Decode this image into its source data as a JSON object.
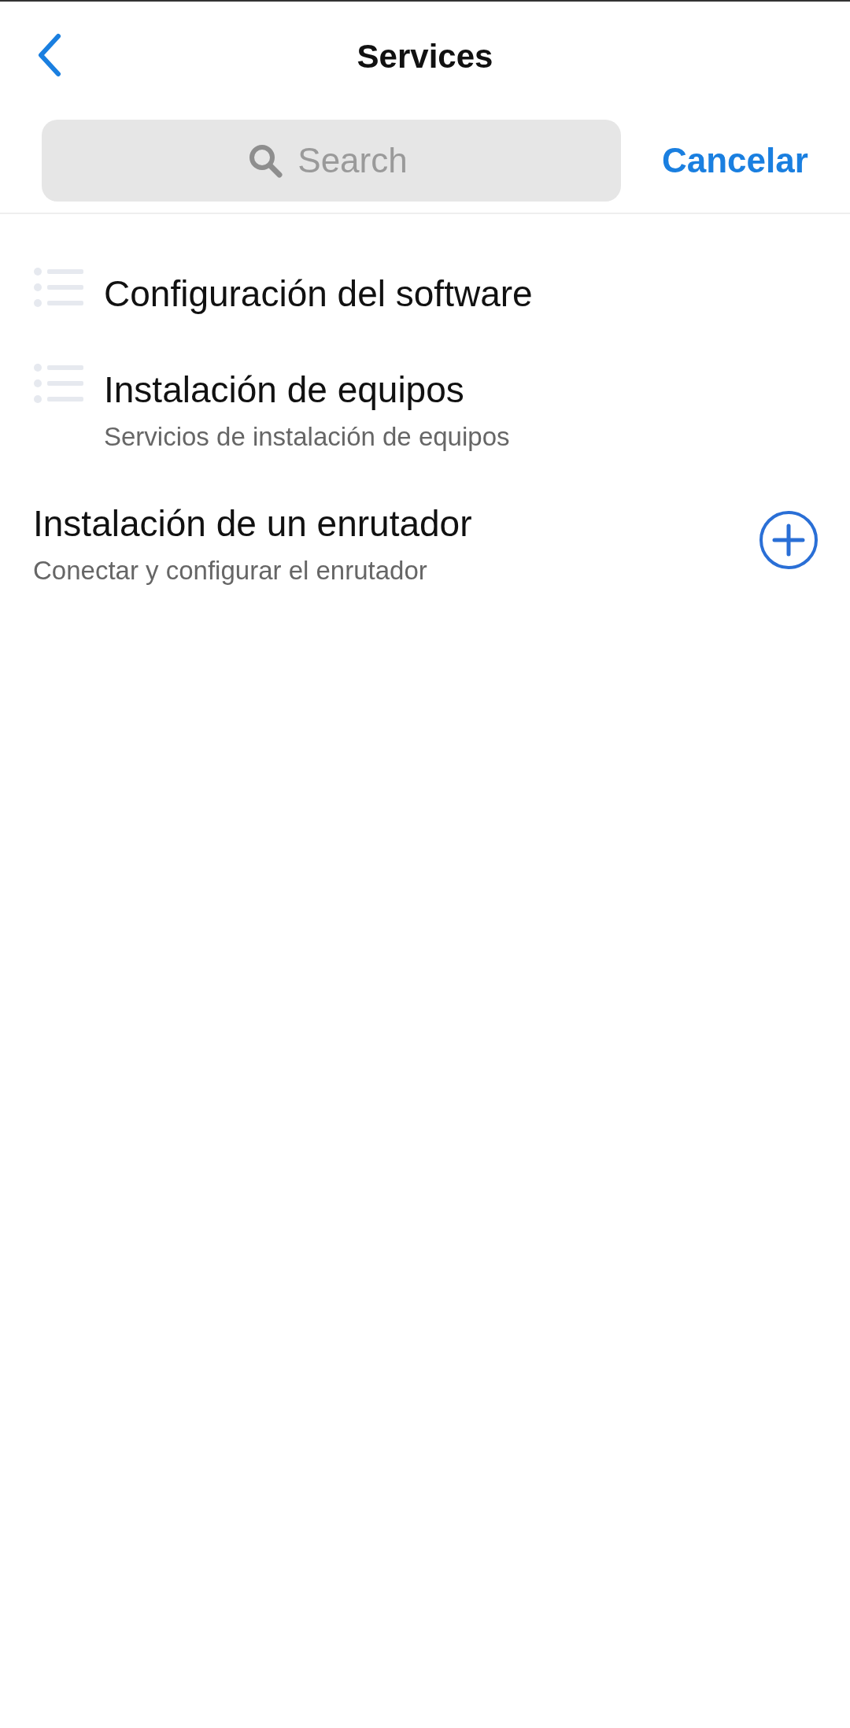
{
  "header": {
    "title": "Services"
  },
  "search": {
    "placeholder": "Search",
    "cancel": "Cancelar"
  },
  "items": [
    {
      "kind": "category",
      "title": "Configuración del software"
    },
    {
      "kind": "category",
      "title": "Instalación de equipos",
      "subtitle": "Servicios de instalación de equipos"
    },
    {
      "kind": "service",
      "title": "Instalación de un enrutador",
      "subtitle": "Conectar y configurar el enrutador"
    }
  ]
}
